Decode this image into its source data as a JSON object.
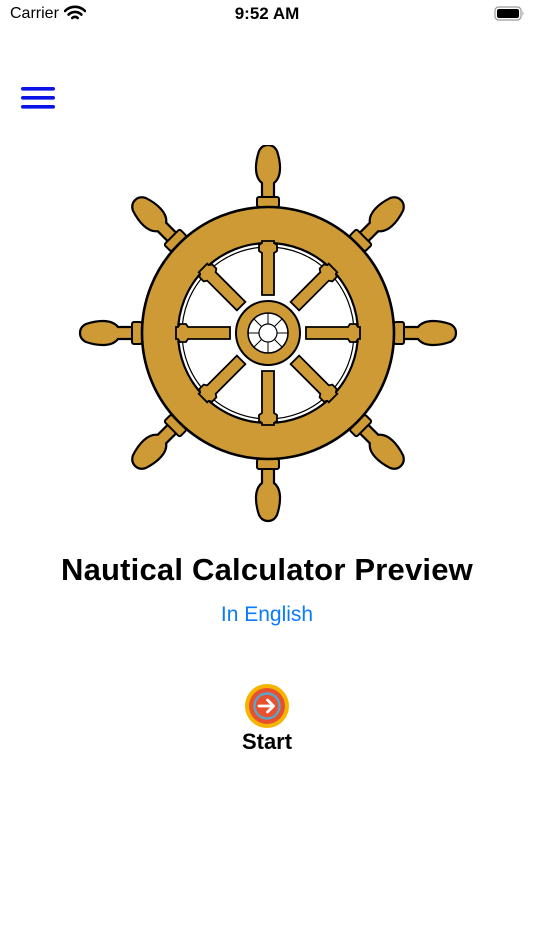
{
  "status_bar": {
    "carrier": "Carrier",
    "time": "9:52 AM",
    "icons": [
      "wifi-icon",
      "battery-icon"
    ]
  },
  "header": {
    "menu_icon": "hamburger-menu-icon",
    "menu_color": "#0a14e6"
  },
  "hero": {
    "image": "ships-wheel",
    "wheel_color": "#cd9a36"
  },
  "main": {
    "title": "Nautical Calculator Preview",
    "language_link": "In English",
    "link_color": "#0a7aff",
    "start_label": "Start",
    "start_icon": "arrow-right-circle-icon"
  }
}
